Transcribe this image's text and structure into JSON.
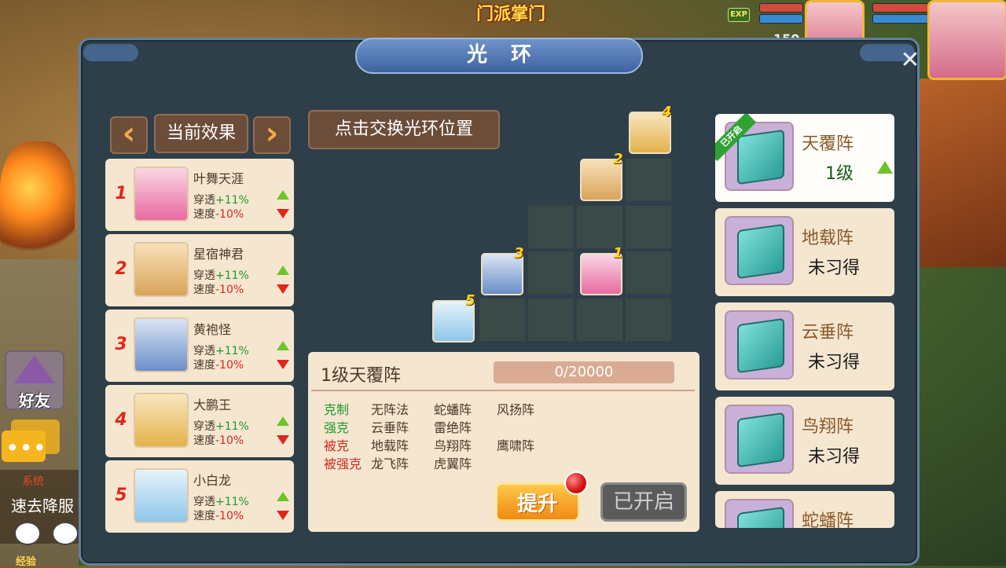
{
  "window": {
    "title": "光环",
    "close_icon": "close-icon"
  },
  "background": {
    "top_title": "门派掌门",
    "exp_badge": "EXP",
    "level_readout": "150"
  },
  "left_panel": {
    "prev_icon": "chevron-left-icon",
    "next_icon": "chevron-right-icon",
    "current_effect_label": "当前效果",
    "heroes": [
      {
        "rank": "1",
        "name": "叶舞天涯",
        "stat1_label": "穿透",
        "stat1_value": "+11%",
        "stat2_label": "速度",
        "stat2_value": "-10%",
        "color": "#e86aa0"
      },
      {
        "rank": "2",
        "name": "星宿神君",
        "stat1_label": "穿透",
        "stat1_value": "+11%",
        "stat2_label": "速度",
        "stat2_value": "-10%",
        "color": "#d9a45a"
      },
      {
        "rank": "3",
        "name": "黄袍怪",
        "stat1_label": "穿透",
        "stat1_value": "+11%",
        "stat2_label": "速度",
        "stat2_value": "-10%",
        "color": "#6a8fc8"
      },
      {
        "rank": "4",
        "name": "大鹏王",
        "stat1_label": "穿透",
        "stat1_value": "+11%",
        "stat2_label": "速度",
        "stat2_value": "-10%",
        "color": "#e4b24a"
      },
      {
        "rank": "5",
        "name": "小白龙",
        "stat1_label": "穿透",
        "stat1_value": "+11%",
        "stat2_label": "速度",
        "stat2_value": "-10%",
        "color": "#8ec6ea"
      }
    ]
  },
  "center": {
    "swap_button": "点击交换光环位置",
    "grid_heroes": [
      {
        "num": "4",
        "name": "大鹏王"
      },
      {
        "num": "2",
        "name": "星宿神君"
      },
      {
        "num": "3",
        "name": "黄袍怪"
      },
      {
        "num": "1",
        "name": "叶舞天涯"
      },
      {
        "num": "5",
        "name": "小白龙"
      }
    ],
    "info_title": "1级天覆阵",
    "progress_text": "0/20000",
    "progress_fraction": 0.0,
    "relations": [
      {
        "label": "克制",
        "color": "#1f9a2e",
        "items": [
          "无阵法",
          "蛇蟠阵",
          "风扬阵"
        ]
      },
      {
        "label": "强克",
        "color": "#1f9a2e",
        "items": [
          "云垂阵",
          "雷绝阵"
        ]
      },
      {
        "label": "被克",
        "color": "#d22a1e",
        "items": [
          "地载阵",
          "鸟翔阵",
          "鹰啸阵"
        ]
      },
      {
        "label": "被强克",
        "color": "#d22a1e",
        "items": [
          "龙飞阵",
          "虎翼阵"
        ]
      }
    ],
    "upgrade_button": "提升",
    "opened_button": "已开启"
  },
  "right_panel": {
    "opened_ribbon": "已开启",
    "formations": [
      {
        "name": "天覆阵",
        "level": "1级",
        "active": true
      },
      {
        "name": "地载阵",
        "status": "未习得"
      },
      {
        "name": "云垂阵",
        "status": "未习得"
      },
      {
        "name": "鸟翔阵",
        "status": "未习得"
      },
      {
        "name": "蛇蟠阵",
        "status": ""
      }
    ]
  },
  "left_hud": {
    "friends_label": "好友",
    "chat_icon": "chat-bubble-icon",
    "system_tag": "系统",
    "system_text": "速去降服",
    "exp_label": "经验"
  }
}
